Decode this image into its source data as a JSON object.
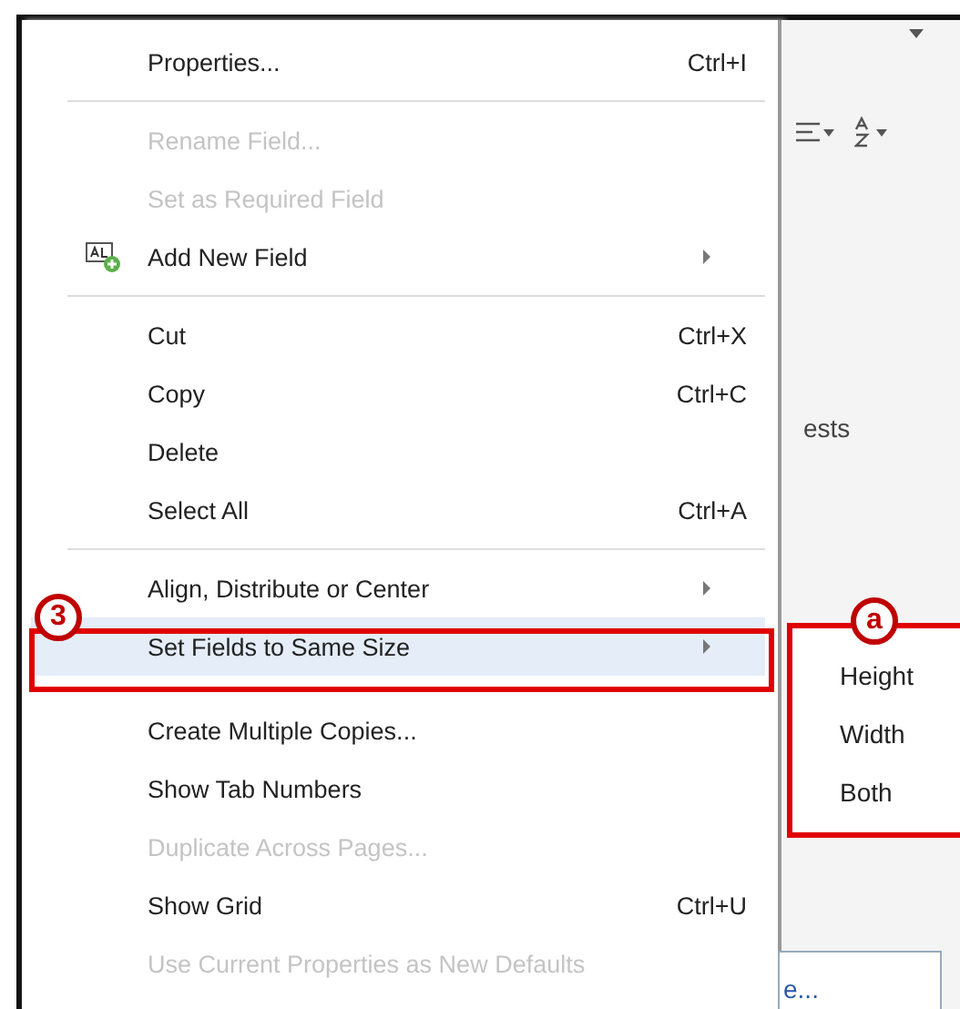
{
  "menu": [
    {
      "kind": "item",
      "label": "Properties...",
      "shortcut": "Ctrl+I",
      "disabled": false,
      "submenu": false,
      "selected": false
    },
    {
      "kind": "separator"
    },
    {
      "kind": "item",
      "label": "Rename Field...",
      "disabled": true,
      "submenu": false,
      "selected": false
    },
    {
      "kind": "item",
      "label": "Set as Required Field",
      "disabled": true,
      "submenu": false,
      "selected": false
    },
    {
      "kind": "field",
      "label": "Add New Field",
      "disabled": false,
      "submenu": true,
      "selected": false
    },
    {
      "kind": "separator"
    },
    {
      "kind": "item",
      "label": "Cut",
      "shortcut": "Ctrl+X",
      "disabled": false,
      "submenu": false,
      "selected": false
    },
    {
      "kind": "item",
      "label": "Copy",
      "shortcut": "Ctrl+C",
      "disabled": false,
      "submenu": false,
      "selected": false
    },
    {
      "kind": "item",
      "label": "Delete",
      "disabled": false,
      "submenu": false,
      "selected": false
    },
    {
      "kind": "item",
      "label": "Select All",
      "shortcut": "Ctrl+A",
      "disabled": false,
      "submenu": false,
      "selected": false
    },
    {
      "kind": "separator"
    },
    {
      "kind": "item",
      "label": "Align, Distribute or Center",
      "disabled": false,
      "submenu": true,
      "selected": false
    },
    {
      "kind": "item",
      "label": "Set Fields to Same Size",
      "disabled": false,
      "submenu": true,
      "selected": true
    },
    {
      "kind": "gap"
    },
    {
      "kind": "item",
      "label": "Create Multiple Copies...",
      "disabled": false,
      "submenu": false,
      "selected": false
    },
    {
      "kind": "item",
      "label": "Show Tab Numbers",
      "disabled": false,
      "submenu": false,
      "selected": false
    },
    {
      "kind": "item",
      "label": "Duplicate Across Pages...",
      "disabled": true,
      "submenu": false,
      "selected": false
    },
    {
      "kind": "item",
      "label": "Show Grid",
      "shortcut": "Ctrl+U",
      "disabled": false,
      "submenu": false,
      "selected": false
    },
    {
      "kind": "item",
      "label": "Use Current Properties as New Defaults",
      "disabled": true,
      "submenu": false,
      "selected": false
    }
  ],
  "submenu": [
    "Height",
    "Width",
    "Both"
  ],
  "callouts": [
    {
      "label": "3",
      "kind": "menu"
    },
    {
      "label": "a",
      "kind": "submenu"
    }
  ],
  "background": {
    "partial_text": "ests",
    "partial_button": "e..."
  }
}
